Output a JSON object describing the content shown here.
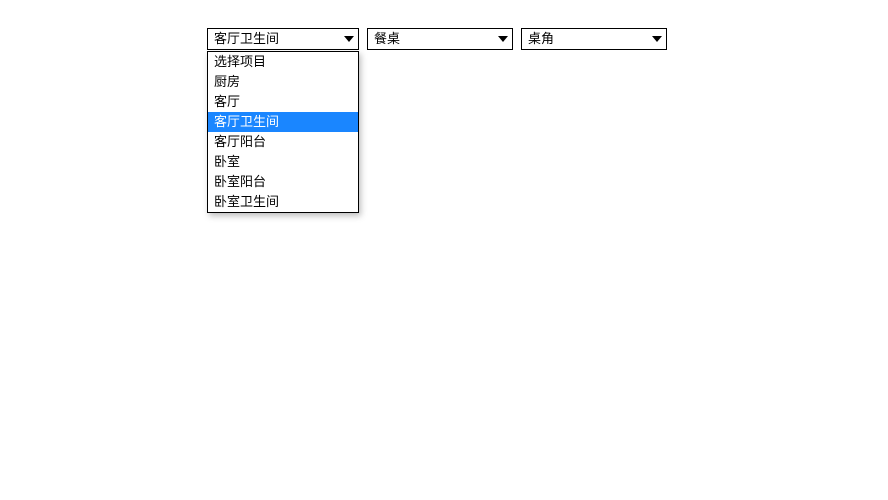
{
  "selects": {
    "room": {
      "value": "客厅卫生间"
    },
    "object": {
      "value": "餐桌"
    },
    "part": {
      "value": "桌角"
    }
  },
  "room_dropdown": {
    "options": [
      "选择项目",
      "厨房",
      "客厅",
      "客厅卫生间",
      "客厅阳台",
      "卧室",
      "卧室阳台",
      "卧室卫生间"
    ],
    "selected_index": 3
  }
}
